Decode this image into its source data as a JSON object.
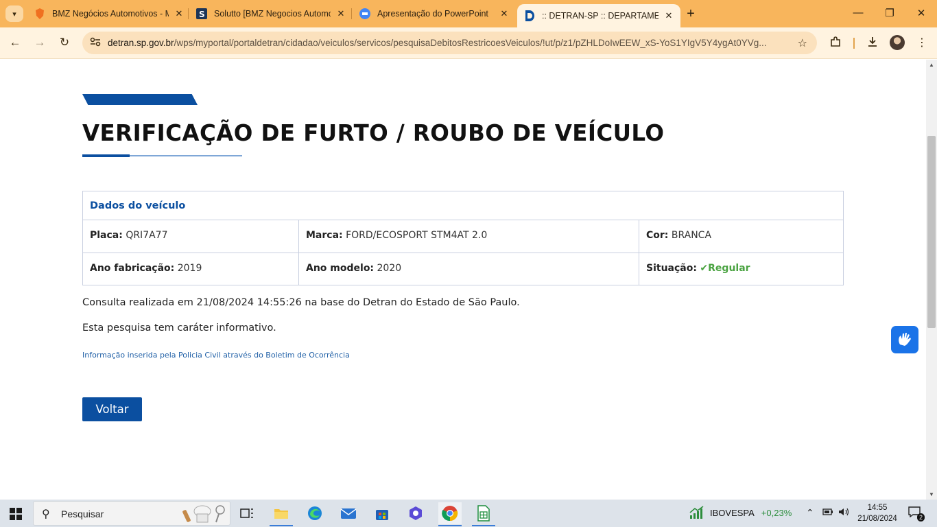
{
  "browser": {
    "tabs": [
      {
        "title": "BMZ Negócios Automotivos - M",
        "active": false
      },
      {
        "title": "Solutto [BMZ Negocios Automo",
        "active": false
      },
      {
        "title": "Apresentação do PowerPoint",
        "active": false
      },
      {
        "title": ":: DETRAN-SP :: DEPARTAMENTO",
        "active": true
      }
    ],
    "url_domain": "detran.sp.gov.br",
    "url_path": "/wps/myportal/portaldetran/cidadao/veiculos/servicos/pesquisaDebitosRestricoesVeiculos/!ut/p/z1/pZHLDoIwEEW_xS-YoS1YIgV5Y4ygAt0YVg..."
  },
  "page": {
    "title": "VERIFICAÇÃO DE FURTO / ROUBO DE VEÍCULO",
    "section_title": "Dados do veículo",
    "rows": [
      [
        {
          "label": "Placa:",
          "value": "QRI7A77"
        },
        {
          "label": "Marca:",
          "value": "FORD/ECOSPORT STM4AT 2.0"
        },
        {
          "label": "Cor:",
          "value": "BRANCA"
        }
      ],
      [
        {
          "label": "Ano fabricação:",
          "value": "2019"
        },
        {
          "label": "Ano modelo:",
          "value": "2020"
        },
        {
          "label": "Situação:",
          "value": "Regular",
          "check": "✔"
        }
      ]
    ],
    "consult_info": "Consulta realizada em 21/08/2024 14:55:26 na base do Detran do Estado de São Paulo.",
    "disclaimer": "Esta pesquisa tem caráter informativo.",
    "police_note": "Informação inserida pela Policia Civil através do Boletim de Ocorrência",
    "back_button": "Voltar",
    "colors": {
      "primary": "#0b4fa0",
      "status_ok": "#4aa341"
    }
  },
  "taskbar": {
    "search_placeholder": "Pesquisar",
    "ticker": "IBOVESPA",
    "ticker_change": "+0,23%",
    "time": "14:55",
    "date": "21/08/2024",
    "notifications": "2",
    "apps": [
      "task-view",
      "file-explorer",
      "edge",
      "mail",
      "store",
      "copilot",
      "chrome",
      "sheets"
    ]
  }
}
